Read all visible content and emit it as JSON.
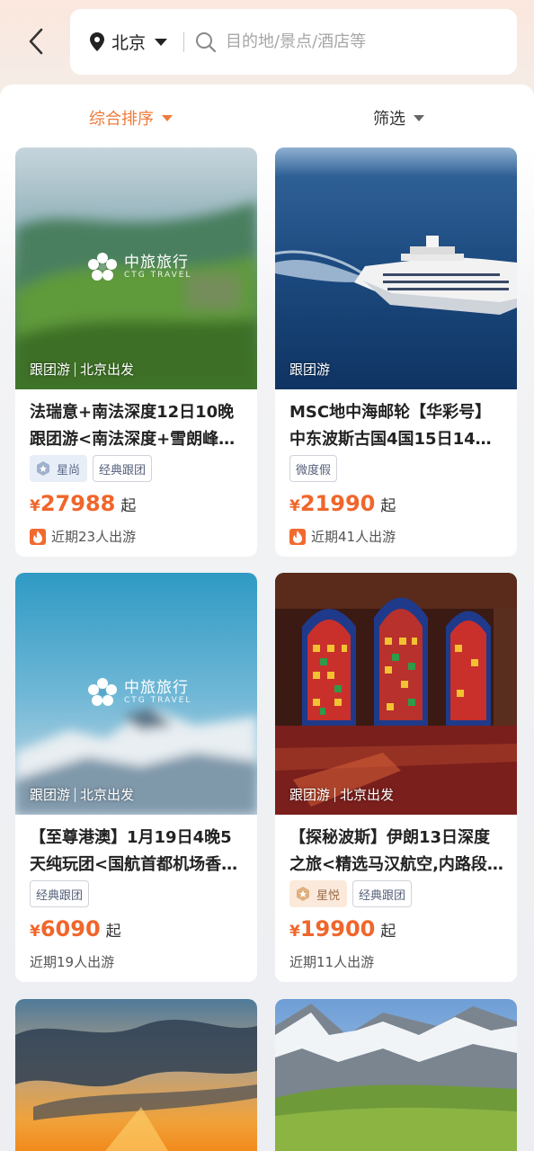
{
  "search": {
    "location": "北京",
    "placeholder": "目的地/景点/酒店等"
  },
  "sortbar": {
    "sort_label": "综合排序",
    "filter_label": "筛选"
  },
  "accent_color": "#ef7a3a",
  "price_color": "#f0662b",
  "cards": [
    {
      "photo_tag": "跟团游",
      "photo_origin": "北京出发",
      "logo_name": "中旅旅行",
      "logo_sub": "CTG TRAVEL",
      "title_line1": "法瑞意+南法深度12日10晚",
      "title_line2": "跟团游<南法深度+雪朗峰+…",
      "tag1": "星尚",
      "tag2": "经典跟团",
      "currency": "¥",
      "price": "27988",
      "price_suffix": "起",
      "recent": "近期23人出游"
    },
    {
      "photo_tag": "跟团游",
      "title_line1": "MSC地中海邮轮【华彩号】",
      "title_line2": "中东波斯古国4国15日14…",
      "tag1": "微度假",
      "currency": "¥",
      "price": "21990",
      "price_suffix": "起",
      "recent": "近期41人出游"
    },
    {
      "photo_tag": "跟团游",
      "photo_origin": "北京出发",
      "logo_name": "中旅旅行",
      "logo_sub": "CTG TRAVEL",
      "title_line1": "【至尊港澳】1月19日4晚5",
      "title_line2": "天纯玩团<国航首都机场香…",
      "tag1": "经典跟团",
      "currency": "¥",
      "price": "6090",
      "price_suffix": "起",
      "recent": "近期19人出游"
    },
    {
      "photo_tag": "跟团游",
      "photo_origin": "北京出发",
      "title_line1": "【探秘波斯】伊朗13日深度",
      "title_line2": "之旅<精选马汉航空,内路段…",
      "tag1": "星悦",
      "tag2": "经典跟团",
      "currency": "¥",
      "price": "19900",
      "price_suffix": "起",
      "recent": "近期11人出游"
    }
  ]
}
